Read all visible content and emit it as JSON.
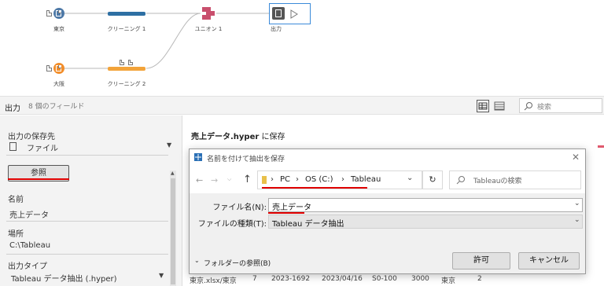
{
  "flow": {
    "nodes": [
      {
        "label": "東京"
      },
      {
        "label": "クリーニング 1"
      },
      {
        "label": "ユニオン 1"
      },
      {
        "label": "出力"
      },
      {
        "label": "大阪"
      },
      {
        "label": "クリーニング 2"
      }
    ],
    "colors": {
      "tokyo": "#4e79a7",
      "osaka": "#f28e2b",
      "clean1": "#2e6fa3",
      "clean2": "#f2a33a",
      "union": "#c94f6d"
    }
  },
  "output_bar": {
    "title": "出力",
    "field_count": "8 個のフィールド",
    "search_placeholder": "検索"
  },
  "left_panel": {
    "save_to_label": "出力の保存先",
    "save_to_value": "ファイル",
    "browse_button": "参照",
    "name_label": "名前",
    "name_value": "売上データ",
    "location_label": "場所",
    "location_value": "C:\\Tableau",
    "output_type_label": "出力タイプ",
    "output_type_value": "Tableau データ抽出 (.hyper)"
  },
  "right_area": {
    "save_heading_bold": "売上データ.hyper",
    "save_heading_rest": " に保存",
    "preview_row": [
      "東京.xlsx/東京",
      "7",
      "2023-1692",
      "2023/04/16",
      "S0-100",
      "3000",
      "東京",
      "2"
    ]
  },
  "dialog": {
    "title": "名前を付けて抽出を保存",
    "breadcrumb": [
      "PC",
      "OS (C:)",
      "Tableau"
    ],
    "search_placeholder": "Tableauの検索",
    "filename_label": "ファイル名(N):",
    "filename_value": "売上データ",
    "filetype_label": "ファイルの種類(T):",
    "filetype_value": "Tableau データ抽出",
    "browse_folders": "フォルダーの参照(B)",
    "ok_button": "許可",
    "cancel_button": "キャンセル"
  }
}
